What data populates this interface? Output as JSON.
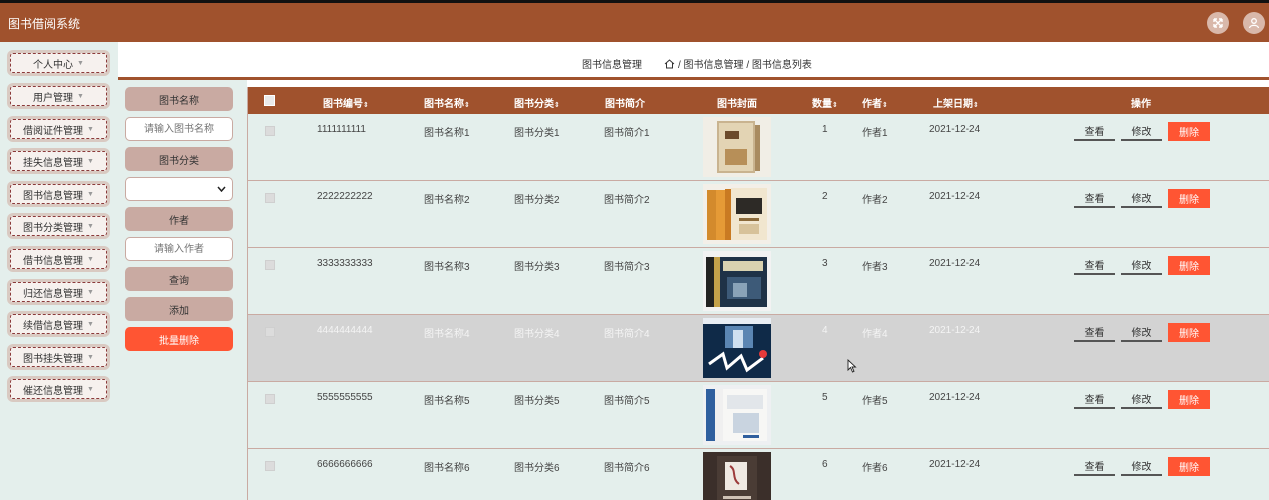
{
  "app": {
    "title": "图书借阅系统"
  },
  "header": {
    "icons": [
      "fullscreen-icon",
      "user-icon"
    ]
  },
  "sidebar": {
    "items": [
      {
        "label": "个人中心"
      },
      {
        "label": "用户管理"
      },
      {
        "label": "借阅证件管理"
      },
      {
        "label": "挂失信息管理"
      },
      {
        "label": "图书信息管理"
      },
      {
        "label": "图书分类管理"
      },
      {
        "label": "借书信息管理"
      },
      {
        "label": "归还信息管理"
      },
      {
        "label": "续借信息管理"
      },
      {
        "label": "图书挂失管理"
      },
      {
        "label": "催还信息管理"
      }
    ]
  },
  "breadcrumb": {
    "title": "图书信息管理",
    "path": "/ 图书信息管理 / 图书信息列表"
  },
  "filter": {
    "name_label": "图书名称",
    "name_placeholder": "请输入图书名称",
    "category_label": "图书分类",
    "category_value": "",
    "author_label": "作者",
    "author_placeholder": "请输入作者",
    "search_label": "查询",
    "add_label": "添加",
    "batch_delete_label": "批量删除"
  },
  "table": {
    "columns": {
      "number": "图书编号",
      "name": "图书名称",
      "category": "图书分类",
      "intro": "图书简介",
      "cover": "图书封面",
      "quantity": "数量",
      "author": "作者",
      "date": "上架日期",
      "actions": "操作"
    },
    "actions": {
      "view": "查看",
      "edit": "修改",
      "delete": "删除"
    },
    "rows": [
      {
        "number": "1111111111",
        "name": "图书名称1",
        "category": "图书分类1",
        "intro": "图书简介1",
        "quantity": "1",
        "author": "作者1",
        "date": "2021-12-24",
        "highlighted": false
      },
      {
        "number": "2222222222",
        "name": "图书名称2",
        "category": "图书分类2",
        "intro": "图书简介2",
        "quantity": "2",
        "author": "作者2",
        "date": "2021-12-24",
        "highlighted": false
      },
      {
        "number": "3333333333",
        "name": "图书名称3",
        "category": "图书分类3",
        "intro": "图书简介3",
        "quantity": "3",
        "author": "作者3",
        "date": "2021-12-24",
        "highlighted": false
      },
      {
        "number": "4444444444",
        "name": "图书名称4",
        "category": "图书分类4",
        "intro": "图书简介4",
        "quantity": "4",
        "author": "作者4",
        "date": "2021-12-24",
        "highlighted": true
      },
      {
        "number": "5555555555",
        "name": "图书名称5",
        "category": "图书分类5",
        "intro": "图书简介5",
        "quantity": "5",
        "author": "作者5",
        "date": "2021-12-24",
        "highlighted": false
      },
      {
        "number": "6666666666",
        "name": "图书名称6",
        "category": "图书分类6",
        "intro": "图书简介6",
        "quantity": "6",
        "author": "作者6",
        "date": "2021-12-24",
        "highlighted": false
      }
    ]
  },
  "colors": {
    "primary": "#a0522d",
    "panel_bg": "#e4efec",
    "danger": "#ff5533",
    "row_highlight": "#d3d3d3"
  }
}
